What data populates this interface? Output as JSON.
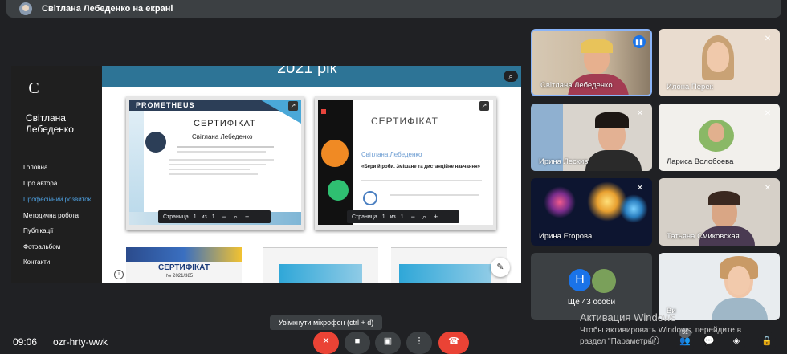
{
  "banner": {
    "text": "Світлана Лебеденко на екрані"
  },
  "site": {
    "owner": "Світлана Лебеденко",
    "logo": "C",
    "year": "2021 рік",
    "menu": [
      "Головна",
      "Про автора",
      "Професійний розвиток",
      "Методична робота",
      "Публікації",
      "Фотоальбом",
      "Контакти"
    ],
    "active_item": "Професійний розвиток"
  },
  "certs": {
    "left": {
      "logo": "PROMETHEUS",
      "title": "СЕРТИФІКАТ",
      "name": "Світлана Лебеденко",
      "pager": {
        "label": "Страница",
        "page": "1",
        "of": "из",
        "total": "1"
      }
    },
    "right": {
      "title": "СЕРТИФІКАТ",
      "name": "Світлана Лебеденко",
      "course": "«Бери й роби. Змішане та дистанційне навчання»",
      "pager": {
        "label": "Страница",
        "page": "1",
        "of": "из",
        "total": "1"
      }
    },
    "lower": {
      "title": "СЕРТИФІКАТ",
      "number": "№ 2021/385"
    }
  },
  "participants": [
    {
      "name": "Світлана Лебеденко",
      "speaking": true
    },
    {
      "name": "Илона Перек"
    },
    {
      "name": "Ирина Лескив"
    },
    {
      "name": "Лариса Волобоева"
    },
    {
      "name": "Ирина Егорова"
    },
    {
      "name": "Татьяна Смиковская"
    },
    {
      "name": "Ще 43 особи",
      "avatar_letter": "Н"
    },
    {
      "name": "Ви"
    }
  ],
  "bottom": {
    "time": "09:06",
    "meeting_code": "ozr-hrty-wwk",
    "tooltip": "Увімкнути мікрофон (ctrl + d)",
    "badge": "51"
  },
  "watermark": {
    "title": "Активация Windows",
    "line1": "Чтобы активировать Windows, перейдите в",
    "line2": "раздел \"Параметры\"."
  },
  "colors": {
    "bg": "#202124",
    "tile": "#3c4043",
    "accent": "#1a73e8",
    "end_call": "#ea4335",
    "site_blue": "#2d7496"
  }
}
